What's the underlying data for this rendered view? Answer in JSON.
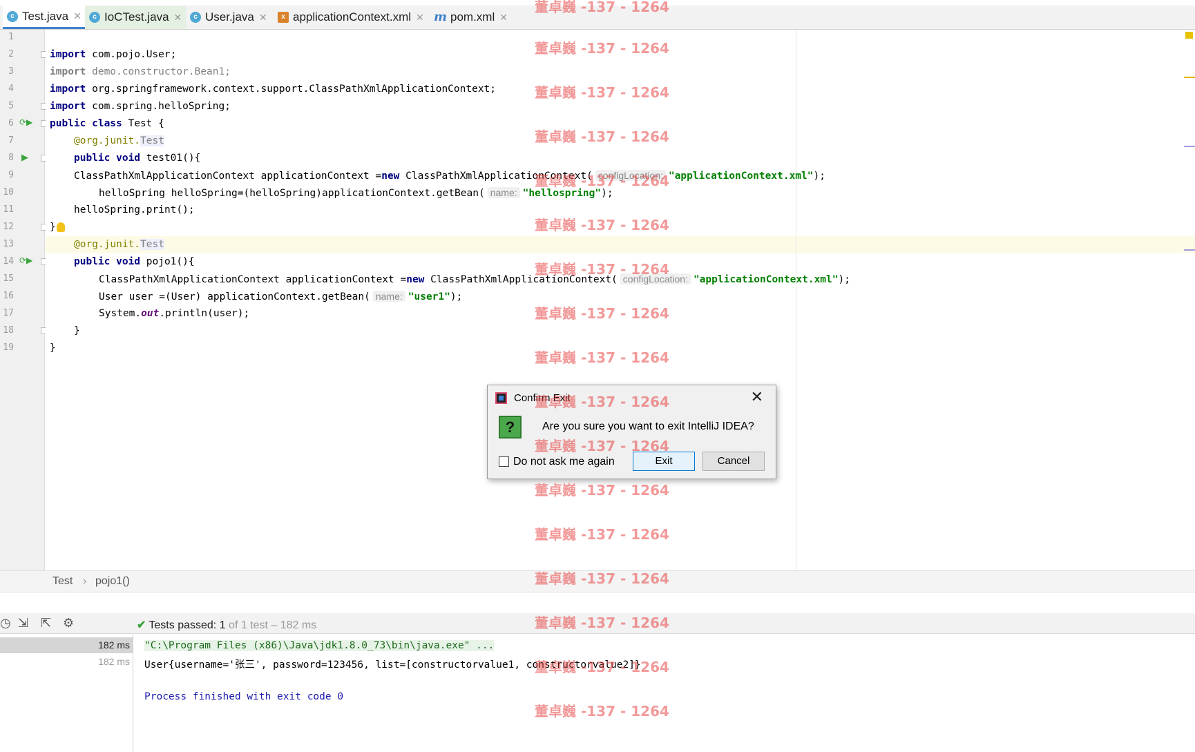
{
  "tabs": [
    {
      "label": "Test.java",
      "icon": "java-class-icon"
    },
    {
      "label": "IoCTest.java",
      "icon": "java-class-icon"
    },
    {
      "label": "User.java",
      "icon": "java-class-icon"
    },
    {
      "label": "applicationContext.xml",
      "icon": "xml-file-icon"
    },
    {
      "label": "pom.xml",
      "icon": "maven-icon"
    }
  ],
  "line_numbers": [
    "1",
    "2",
    "3",
    "4",
    "5",
    "6",
    "7",
    "8",
    "9",
    "10",
    "11",
    "12",
    "13",
    "14",
    "15",
    "16",
    "17",
    "18",
    "19"
  ],
  "code": {
    "l2_kw": "import",
    "l2_rest": " com.pojo.User;",
    "l3_kw": "import",
    "l3_rest": " demo.constructor.Bean1;",
    "l4_kw": "import",
    "l4_rest": " org.springframework.context.support.ClassPathXmlApplicationContext;",
    "l5_kw": "import",
    "l5_rest": " com.spring.helloSpring;",
    "l6_kw": "public class",
    "l6_rest": " Test {",
    "l7_ann": "@org.junit.",
    "l7_test": "Test",
    "l8_kw": "public void",
    "l8_rest": " test01(){",
    "l9_a": "ClassPathXmlApplicationContext applicationContext =",
    "l9_kw": "new",
    "l9_b": " ClassPathXmlApplicationContext(",
    "l9_hint": "configLocation:",
    "l9_str": "\"applicationContext.xml\"",
    "l9_end": ");",
    "l10_a": "helloSpring helloSpring=(helloSpring)applicationContext.getBean(",
    "l10_hint": "name:",
    "l10_str": "\"hellospring\"",
    "l10_end": ");",
    "l11": "helloSpring.print();",
    "l12": "}",
    "l13_ann": "@org.junit.",
    "l13_test": "Test",
    "l14_kw": "public void",
    "l14_rest": " pojo1(){",
    "l15_a": "ClassPathXmlApplicationContext applicationContext =",
    "l15_kw": "new",
    "l15_b": " ClassPathXmlApplicationContext(",
    "l15_hint": "configLocation:",
    "l15_str": "\"applicationContext.xml\"",
    "l15_end": ");",
    "l16_a": "User user =(User) applicationContext.getBean(",
    "l16_hint": "name:",
    "l16_str": "\"user1\"",
    "l16_end": ");",
    "l17_a": "System.",
    "l17_static": "out",
    "l17_b": ".println(user);",
    "l18": "}",
    "l19": "}"
  },
  "breadcrumb": {
    "class": "Test",
    "separator": "›",
    "method": "pojo1()"
  },
  "run": {
    "tests_passed_label": "Tests passed:",
    "tests_passed_count": "1",
    "tests_passed_detail": "of 1 test – 182 ms",
    "times": [
      "182 ms",
      "182 ms"
    ],
    "output": [
      "\"C:\\Program Files (x86)\\Java\\jdk1.8.0_73\\bin\\java.exe\" ...",
      "User{username='张三', password=123456, list=[constructorvalue1, constructorvalue2]}",
      "Process finished with exit code 0"
    ]
  },
  "dialog": {
    "title": "Confirm Exit",
    "message": "Are you sure you want to exit IntelliJ IDEA?",
    "question_glyph": "?",
    "checkbox_label": "Do not ask me again",
    "checkbox_checked": false,
    "exit_label": "Exit",
    "cancel_label": "Cancel",
    "close_glyph": "✕"
  },
  "watermark": "董卓巍 -137 - 1264",
  "colors": {
    "keyword": "#000080",
    "string": "#008000",
    "accent": "#4083c9",
    "watermark": "#e84646"
  }
}
